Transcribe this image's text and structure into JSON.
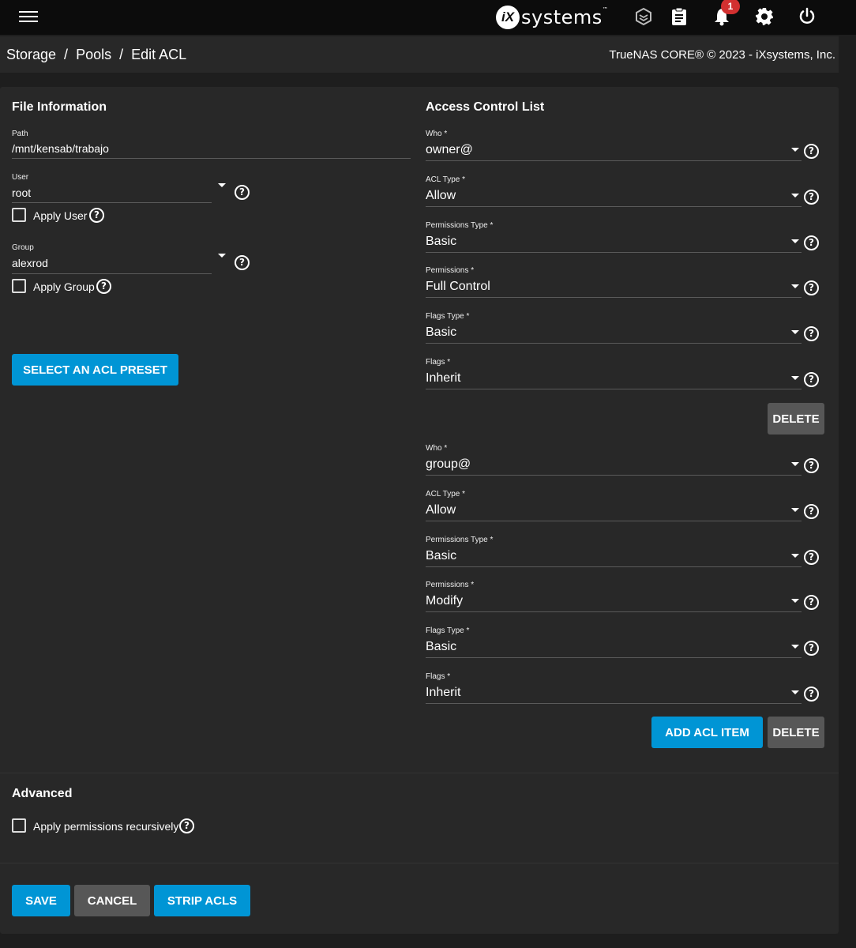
{
  "topbar": {
    "menu_icon": "hamburger-menu-icon",
    "logo_mark": "iX",
    "logo_text": "systems",
    "logo_tm": "™",
    "notifications_count": "1"
  },
  "header": {
    "breadcrumb": [
      "Storage",
      "Pools",
      "Edit ACL"
    ],
    "separator": "/",
    "copyright": "TrueNAS CORE® © 2023 - iXsystems, Inc."
  },
  "file_info": {
    "title": "File Information",
    "path_label": "Path",
    "path_value": "/mnt/kensab/trabajo",
    "user_label": "User",
    "user_value": "root",
    "apply_user_label": "Apply User",
    "group_label": "Group",
    "group_value": "alexrod",
    "apply_group_label": "Apply Group",
    "preset_button": "SELECT AN ACL PRESET"
  },
  "acl": {
    "title": "Access Control List",
    "entries": [
      {
        "who_label": "Who *",
        "who": "owner@",
        "acl_type_label": "ACL Type *",
        "acl_type": "Allow",
        "perm_type_label": "Permissions Type *",
        "perm_type": "Basic",
        "perms_label": "Permissions *",
        "perms": "Full Control",
        "flags_type_label": "Flags Type *",
        "flags_type": "Basic",
        "flags_label": "Flags *",
        "flags": "Inherit",
        "delete_label": "DELETE"
      },
      {
        "who_label": "Who *",
        "who": "group@",
        "acl_type_label": "ACL Type *",
        "acl_type": "Allow",
        "perm_type_label": "Permissions Type *",
        "perm_type": "Basic",
        "perms_label": "Permissions *",
        "perms": "Modify",
        "flags_type_label": "Flags Type *",
        "flags_type": "Basic",
        "flags_label": "Flags *",
        "flags": "Inherit",
        "delete_label": "DELETE"
      }
    ],
    "add_button": "ADD ACL ITEM"
  },
  "advanced": {
    "title": "Advanced",
    "recursive_label": "Apply permissions recursively"
  },
  "actions": {
    "save": "SAVE",
    "cancel": "CANCEL",
    "strip": "STRIP ACLS"
  },
  "help_glyph": "?",
  "colors": {
    "primary": "#0095d5",
    "grey_button": "#575757",
    "card": "#282828",
    "badge": "#d23030"
  }
}
